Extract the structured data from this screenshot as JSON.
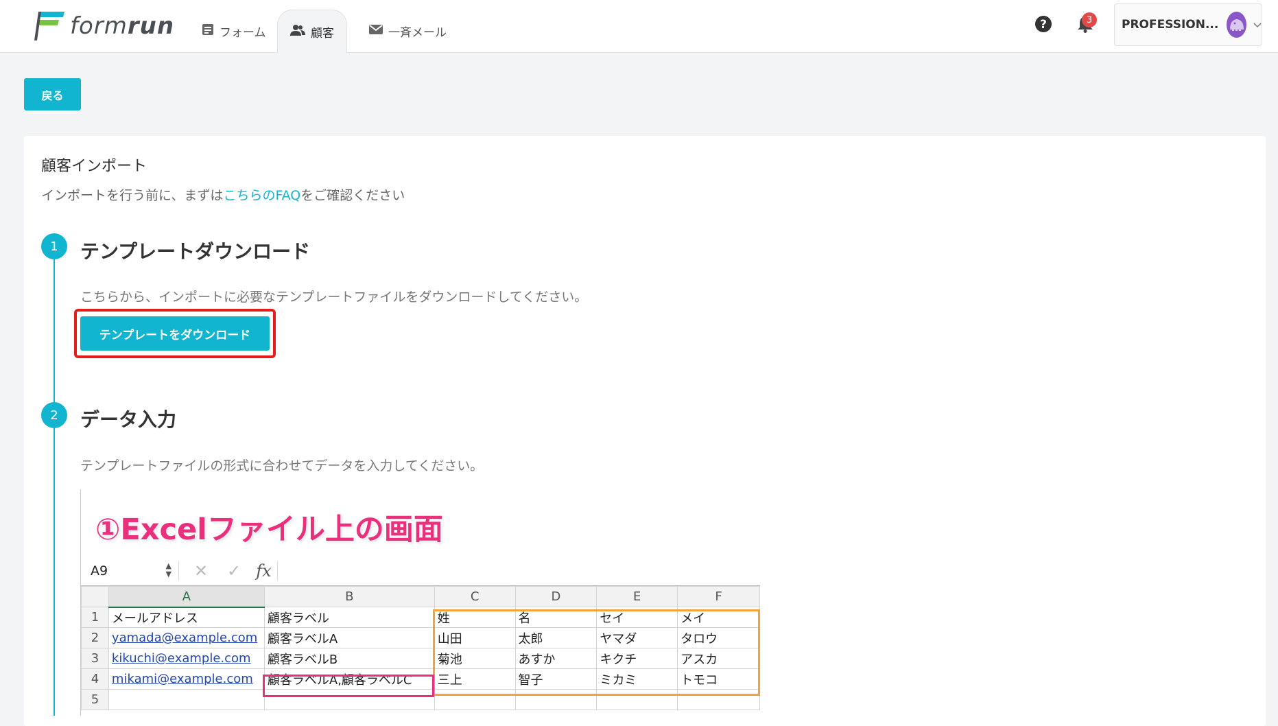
{
  "header": {
    "logo": "formrun",
    "tabs": [
      {
        "label": "フォーム",
        "icon": "form-icon"
      },
      {
        "label": "顧客",
        "icon": "users-icon"
      },
      {
        "label": "一斉メール",
        "icon": "mail-icon"
      }
    ],
    "notification_count": "3",
    "plan_label": "PROFESSION...",
    "colors": {
      "accent": "#12b5cf",
      "badge": "#e24a4a"
    }
  },
  "back_button": "戻る",
  "page": {
    "title": "顧客インポート",
    "desc_prefix": "インポートを行う前に、まずは",
    "desc_link": "こちらのFAQ",
    "desc_suffix": "をご確認ください"
  },
  "steps": [
    {
      "number": "1",
      "title": "テンプレートダウンロード",
      "text": "こちらから、インポートに必要なテンプレートファイルをダウンロードしてください。",
      "button": "テンプレートをダウンロード"
    },
    {
      "number": "2",
      "title": "データ入力",
      "text": "テンプレートファイルの形式に合わせてデータを入力してください。"
    }
  ],
  "excel_sample": {
    "caption": "①Excelファイル上の画面",
    "cell_ref": "A9",
    "formula_icons": [
      "✕",
      "✓",
      "fx"
    ],
    "columns": [
      "A",
      "B",
      "C",
      "D",
      "E",
      "F"
    ],
    "rows": [
      {
        "num": "1",
        "cells": [
          "メールアドレス",
          "顧客ラベル",
          "姓",
          "名",
          "セイ",
          "メイ"
        ]
      },
      {
        "num": "2",
        "cells": [
          "yamada@example.com",
          "顧客ラベルA",
          "山田",
          "太郎",
          "ヤマダ",
          "タロウ"
        ]
      },
      {
        "num": "3",
        "cells": [
          "kikuchi@example.com",
          "顧客ラベルB",
          "菊池",
          "あすか",
          "キクチ",
          "アスカ"
        ]
      },
      {
        "num": "4",
        "cells": [
          "mikami@example.com",
          "顧客ラベルA,顧客ラベルC",
          "三上",
          "智子",
          "ミカミ",
          "トモコ"
        ]
      },
      {
        "num": "5",
        "cells": [
          "",
          "",
          "",
          "",
          "",
          ""
        ]
      }
    ]
  }
}
